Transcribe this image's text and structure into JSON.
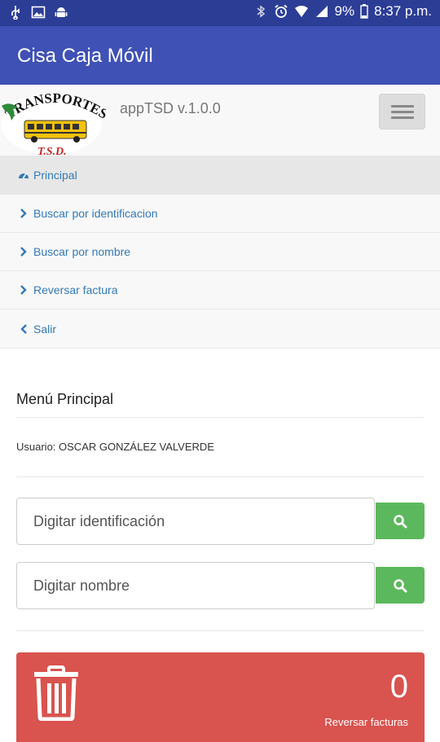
{
  "status_bar": {
    "battery": "9%",
    "time": "8:37 p.m.",
    "icons": [
      "usb-icon",
      "image-icon",
      "android-icon",
      "bluetooth-icon",
      "alarm-icon",
      "wifi-icon",
      "signal-icon",
      "battery-icon"
    ]
  },
  "app_bar": {
    "title": "Cisa Caja Móvil"
  },
  "header": {
    "logo_text_top": "TRANSPORTES",
    "logo_text_bottom": "T.S.D.",
    "brand": "appTSD v.1.0.0"
  },
  "nav": {
    "items": [
      {
        "label": "Principal",
        "icon": "dashboard-icon",
        "active": true
      },
      {
        "label": "Buscar por identificacion",
        "icon": "chevron-right-icon"
      },
      {
        "label": "Buscar por nombre",
        "icon": "chevron-right-icon"
      },
      {
        "label": "Reversar factura",
        "icon": "chevron-right-icon"
      },
      {
        "label": "Salir",
        "icon": "chevron-left-icon"
      }
    ]
  },
  "main": {
    "title": "Menú Principal",
    "user": "Usuario: OSCAR GONZÁLEZ VALVERDE",
    "search_id": {
      "placeholder": "Digitar identificación"
    },
    "search_name": {
      "placeholder": "Digitar nombre"
    },
    "panel": {
      "count": "0",
      "label": "Reversar facturas",
      "color": "#d9534f"
    }
  },
  "colors": {
    "status_bar": "#2c3d96",
    "app_bar": "#3f51b5",
    "link": "#337ab7",
    "success": "#5cb85c",
    "danger": "#d9534f"
  }
}
